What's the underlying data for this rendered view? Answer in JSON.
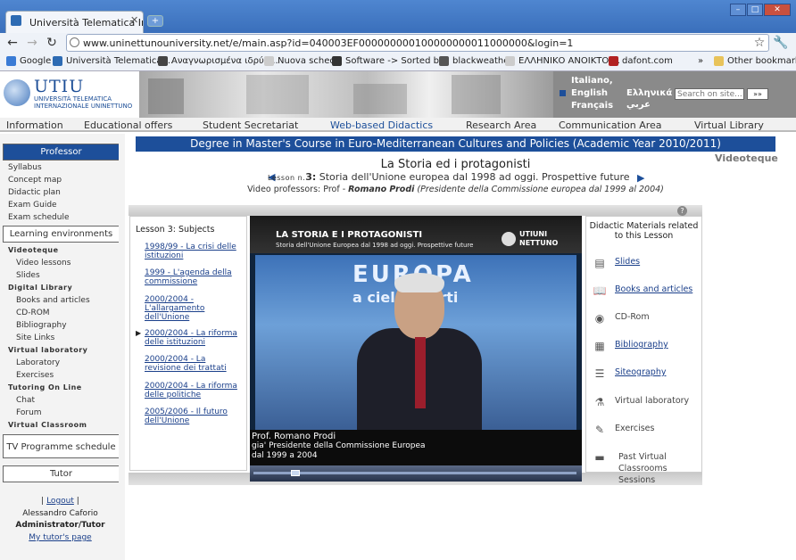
{
  "browser": {
    "tab_title": "Università Telematica Inter...",
    "url": "www.uninettunouniversity.net/e/main.asp?id=040003EF000000000100000000011000000&login=1",
    "bookmarks": [
      {
        "label": "Google",
        "color": "#3a7bd5"
      },
      {
        "label": "Università Telematica ...",
        "color": "#2d6bb3"
      },
      {
        "label": "Αναγνωρισμένα ιδρύμ...",
        "color": "#444444"
      },
      {
        "label": "Nuova scheda",
        "color": "#cccccc"
      },
      {
        "label": "Software -> Sorted b...",
        "color": "#333333"
      },
      {
        "label": "blackweather",
        "color": "#555555"
      },
      {
        "label": "ΕΛΛΗΝΙΚΟ ΑΝΟΙΚΤΟ ...",
        "color": "#cccccc"
      },
      {
        "label": "dafont.com",
        "color": "#b22222"
      }
    ],
    "other_bookmarks": "Other bookmarks"
  },
  "header": {
    "logo_title": "UTIU",
    "logo_line1": "UNIVERSITÀ TELEMATICA",
    "logo_line2": "INTERNAZIONALE UNINETTUNO",
    "languages": [
      "Italiano,",
      "English",
      "Ελληνικά",
      "Français",
      "عربي"
    ],
    "search_placeholder": "Search on site...",
    "search_go": "»»"
  },
  "nav": [
    "Information",
    "Educational offers",
    "Student Secretariat",
    "Web-based Didactics",
    "Research Area",
    "Communication Area",
    "Virtual Library"
  ],
  "sidebar": {
    "professor": "Professor",
    "items1": [
      "Syllabus",
      "Concept map",
      "Didactic plan",
      "Exam Guide",
      "Exam schedule"
    ],
    "learning": "Learning environments",
    "sec_videoteque": "Videoteque",
    "videoteque_items": [
      "Video lessons",
      "Slides"
    ],
    "sec_library": "Digital Library",
    "library_items": [
      "Books and articles",
      "CD-ROM",
      "Bibliography",
      "Site Links"
    ],
    "sec_lab": "Virtual laboratory",
    "lab_items": [
      "Laboratory",
      "Exercises"
    ],
    "sec_tutoring": "Tutoring On Line",
    "tutoring_items": [
      "Chat",
      "Forum"
    ],
    "sec_classroom": "Virtual Classroom",
    "tv": "TV Programme schedule",
    "tutor": "Tutor",
    "logout": "Logout",
    "user_name": "Alessandro Caforio",
    "user_role": "Administrator/Tutor",
    "my_tutor": "My tutor's page"
  },
  "content": {
    "course": "Degree in Master's Course in Euro-Mediterranean Cultures and Policies (Academic Year 2010/2011)",
    "videoteque": "Videoteque",
    "lesson_title": "La Storia ed i protagonisti",
    "lesson_prefix": "Lesson n.",
    "lesson_number": "3:",
    "lesson_desc": "Storia dell'Unione europea dal 1998 ad oggi. Prospettive future",
    "video_prof_label": "Video professors: Prof -",
    "video_prof_name": "Romano Prodi",
    "video_prof_role": "(Presidente della Commissione europea dal 1999 al 2004)",
    "subjects_title": "Lesson 3: Subjects",
    "subjects": [
      "1998/99 - La crisi delle istituzioni",
      "1999 - L'agenda della commissione",
      "2000/2004 - L'allargamento dell'Unione",
      "2000/2004 - La riforma delle istituzioni",
      "2000/2004 - La revisione dei trattati",
      "2000/2004 - La riforma delle politiche",
      "2005/2006 - Il futuro dell'Unione"
    ],
    "video": {
      "title": "LA STORIA E I PROTAGONISTI",
      "subtitle": "Storia dell'Unione Europea dal 1998 ad oggi. Prospettive future",
      "brand1": "UTIUNI",
      "brand2": "NETTUNO",
      "backdrop": "EUROPA",
      "backdrop2": "a cielo aperti",
      "caption1": "Prof. Romano Prodi",
      "caption2": "gia' Presidente della Commissione Europea",
      "caption3": "dal 1999 a 2004"
    },
    "materials_title": "Didactic Materials related to this Lesson",
    "materials": [
      {
        "label": "Slides",
        "icon": "slides-icon",
        "link": true
      },
      {
        "label": "Books and articles",
        "icon": "book-icon",
        "link": true
      },
      {
        "label": "CD-Rom",
        "icon": "cdrom-icon",
        "link": false
      },
      {
        "label": "Bibliography",
        "icon": "bibliography-icon",
        "link": true
      },
      {
        "label": "Siteography",
        "icon": "siteography-icon",
        "link": true
      },
      {
        "label": "Virtual laboratory",
        "icon": "lab-icon",
        "link": false
      },
      {
        "label": "Exercises",
        "icon": "exercises-icon",
        "link": false
      },
      {
        "label": "Past Virtual Classrooms Sessions",
        "icon": "classroom-icon",
        "link": false
      }
    ]
  },
  "colors": {
    "course_bar": "#1d4f9a",
    "link": "#1a3f8a"
  }
}
